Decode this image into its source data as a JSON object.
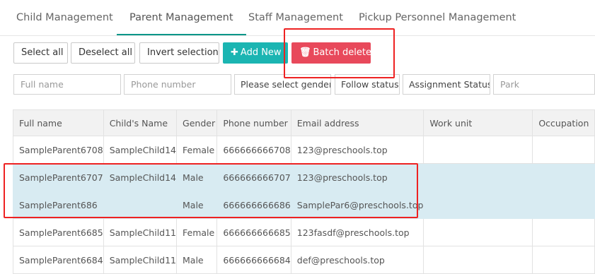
{
  "tabs": [
    {
      "label": "Child Management"
    },
    {
      "label": "Parent Management"
    },
    {
      "label": "Staff Management"
    },
    {
      "label": "Pickup Personnel Management"
    }
  ],
  "toolbar": {
    "select_all": "Select all",
    "deselect_all": "Deselect all",
    "invert_selection": "Invert selection",
    "add_new": "Add New",
    "batch_delete": "Batch delete"
  },
  "filters": {
    "full_name_placeholder": "Full name",
    "phone_placeholder": "Phone number",
    "gender_select": "Please select gender",
    "follow_status": "Follow status",
    "assignment_status": "Assignment Status",
    "park_placeholder": "Park"
  },
  "table": {
    "headers": [
      "Full name",
      "Child's Name",
      "Gender",
      "Phone number",
      "Email address",
      "Work unit",
      "Occupation"
    ],
    "rows": [
      [
        "SampleParent6708",
        "SampleChild14",
        "Female",
        "666666666708",
        "123@preschools.top",
        "",
        ""
      ],
      [
        "SampleParent6707",
        "SampleChild14",
        "Male",
        "666666666707",
        "123@preschools.top",
        "",
        ""
      ],
      [
        "SampleParent686",
        "",
        "Male",
        "666666666686",
        "SamplePar6@preschools.top",
        "",
        ""
      ],
      [
        "SampleParent6685",
        "SampleChild11",
        "Female",
        "666666666685",
        "123fasdf@preschools.top",
        "",
        ""
      ],
      [
        "SampleParent6684",
        "SampleChild11",
        "Male",
        "666666666684",
        "def@preschools.top",
        "",
        ""
      ]
    ]
  },
  "colors": {
    "accent_teal": "#1bb5b2",
    "danger_red": "#e8495b",
    "selected_row": "#d8ebf2",
    "annotation_red": "#ee2222"
  },
  "icons": {
    "add": "plus-icon",
    "delete": "trash-icon"
  }
}
